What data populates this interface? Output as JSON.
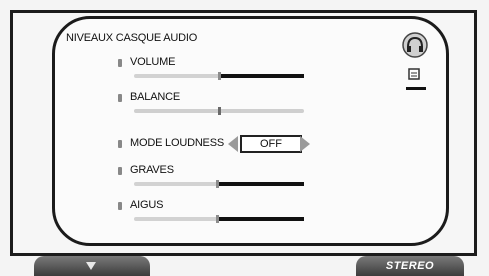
{
  "panel": {
    "title": "NIVEAUX CASQUE AUDIO"
  },
  "settings": [
    {
      "label": "VOLUME",
      "level": 0.53
    },
    {
      "label": "BALANCE",
      "level": 0.5
    },
    {
      "label": "MODE LOUDNESS",
      "value": "OFF"
    },
    {
      "label": "GRAVES",
      "level": 0.5
    },
    {
      "label": "AIGUS",
      "level": 0.5
    }
  ],
  "footer": {
    "right_button_label": "STEREO",
    "left_button_icon": "down-arrow-icon"
  },
  "icons": {
    "top_right": "headphone-icon",
    "below": "volume-meter-icon"
  }
}
